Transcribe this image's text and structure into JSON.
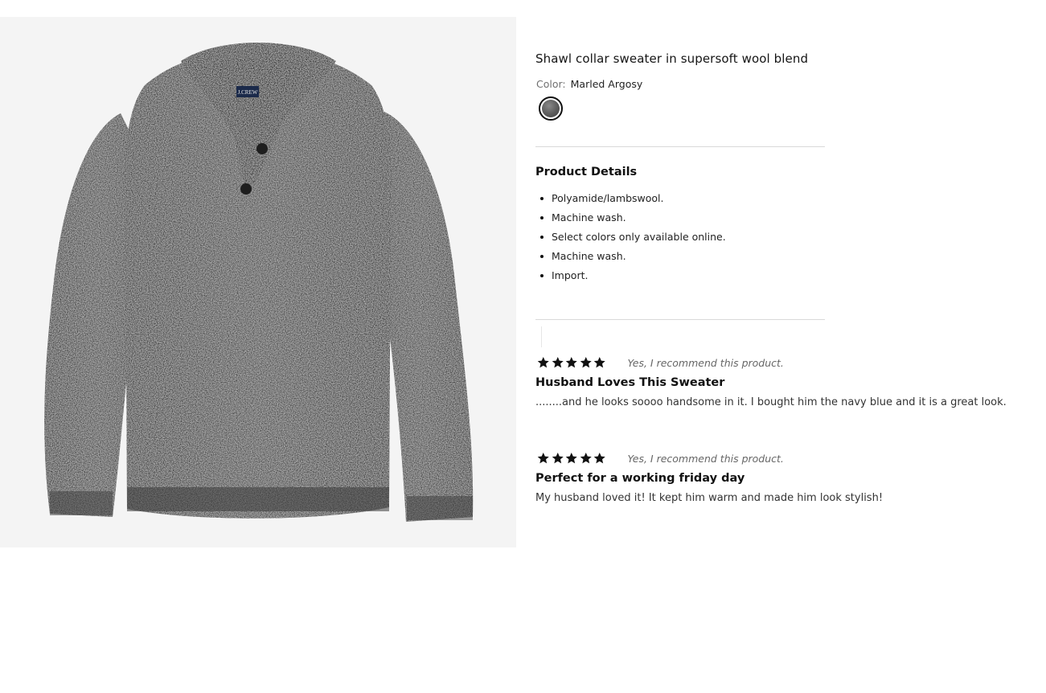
{
  "product": {
    "image_alt": "Shawl collar sweater",
    "brand_tag": "J.CREW",
    "title": "Shawl collar sweater in supersoft wool blend",
    "color_label": "Color:",
    "color_value": "Marled Argosy",
    "swatch_color": "#5b5b5b"
  },
  "details": {
    "heading": "Product Details",
    "items": [
      "Polyamide/lambswool.",
      "Machine wash.",
      "Select colors only available online.",
      "Machine wash.",
      "Import."
    ]
  },
  "reviews": [
    {
      "rating": 5,
      "recommend": "Yes, I recommend this product.",
      "title": "Husband Loves This Sweater",
      "body": "........and he looks soooo handsome in it. I bought him the navy blue and it is a great look."
    },
    {
      "rating": 5,
      "recommend": "Yes, I recommend this product.",
      "title": "Perfect for a working friday day",
      "body": "My husband loved it! It kept him warm and made him look stylish!"
    }
  ],
  "icons": {
    "star": "star-icon",
    "swatch": "color-swatch"
  }
}
